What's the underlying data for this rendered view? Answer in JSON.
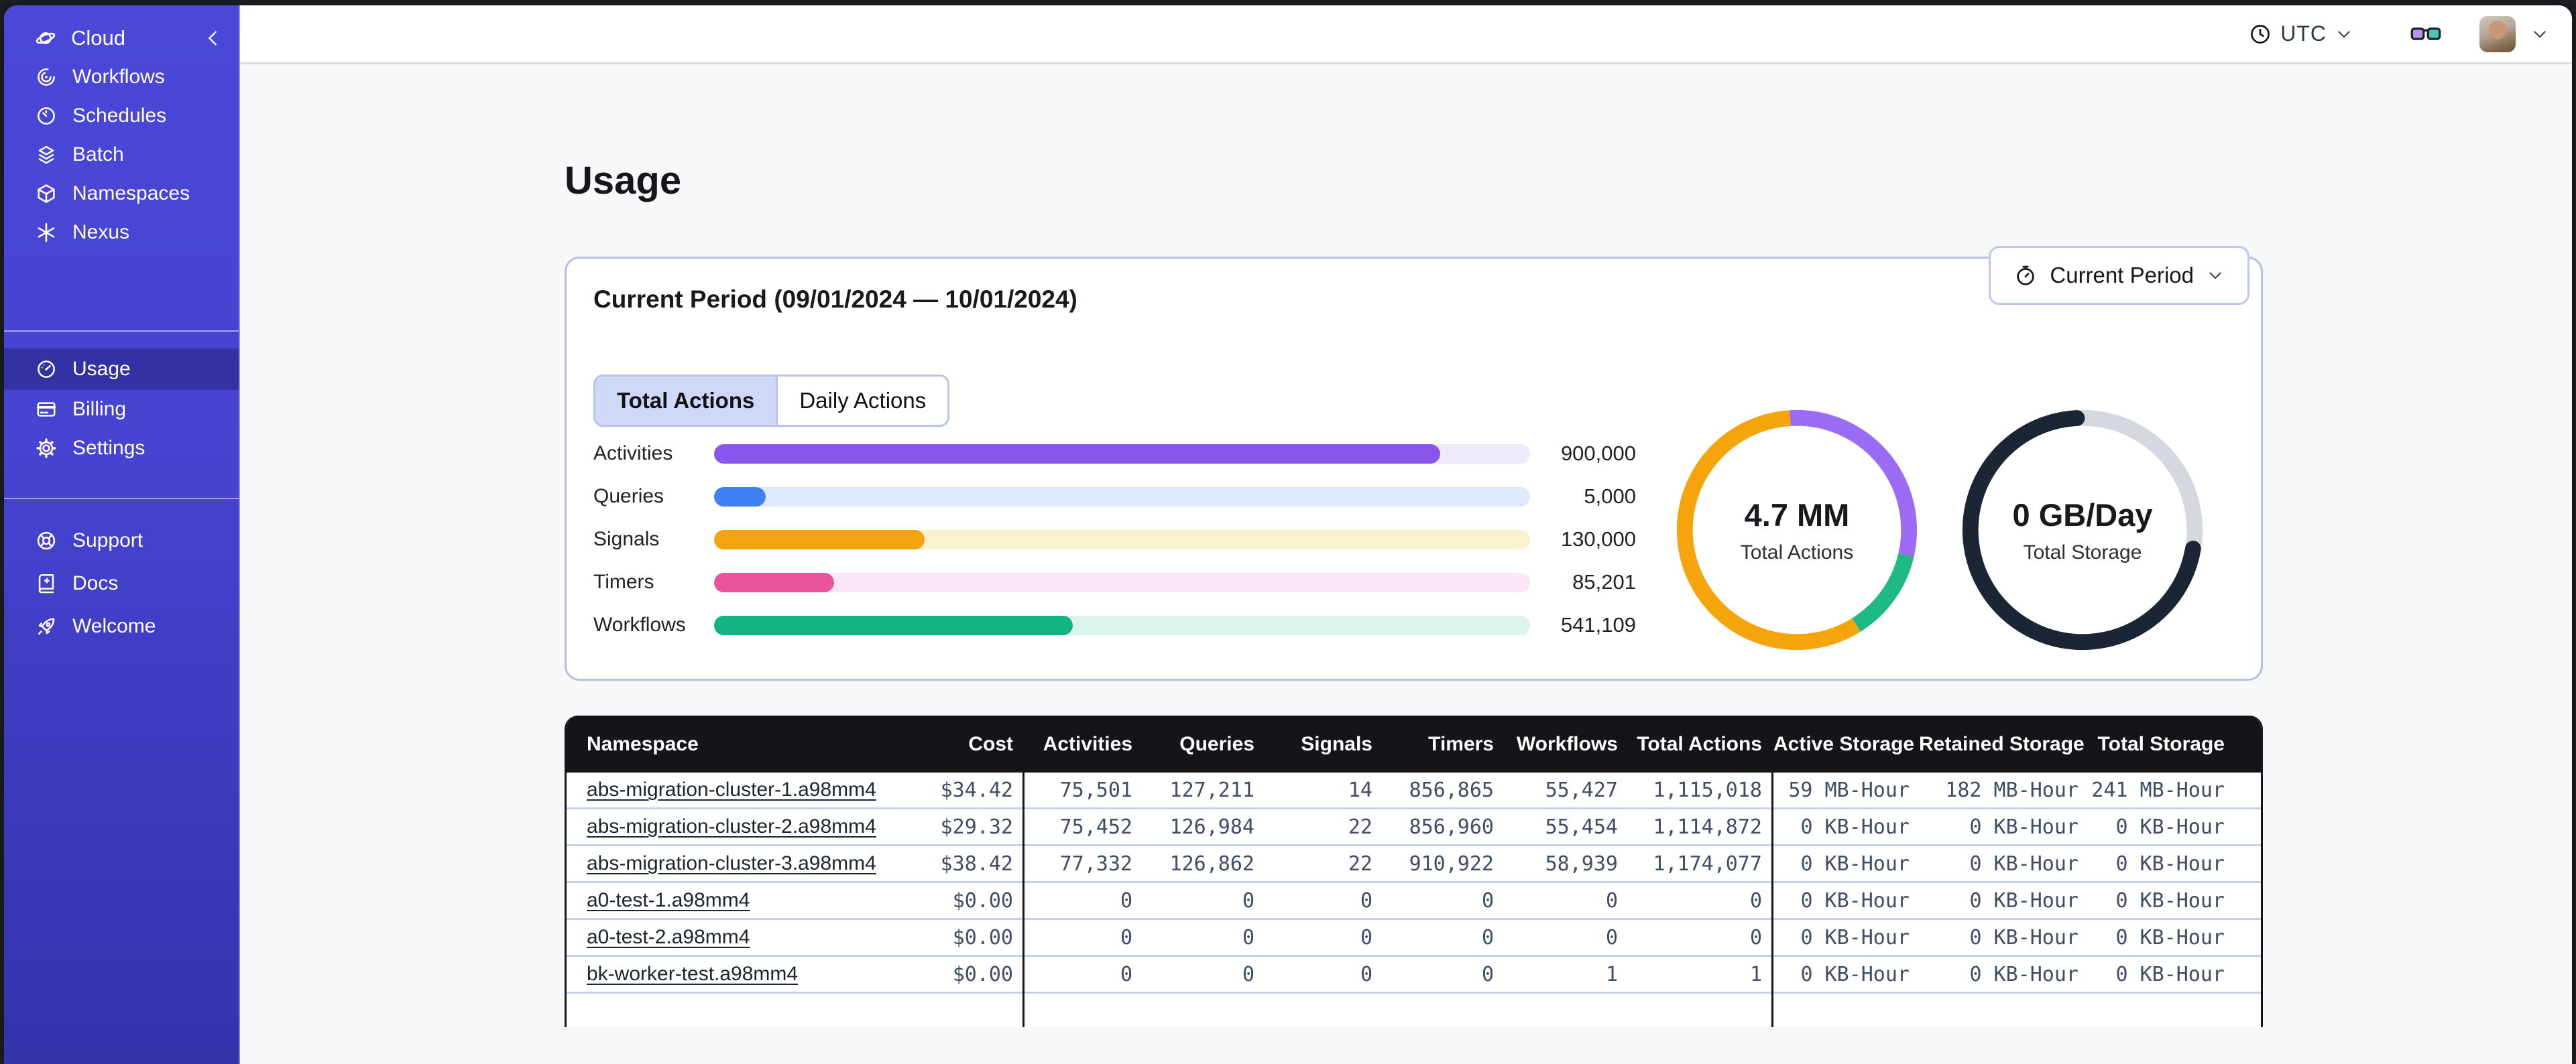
{
  "topbar": {
    "timezone_label": "UTC",
    "icons": [
      "clock-icon",
      "goggles-icon",
      "avatar",
      "chevron-down-icon"
    ]
  },
  "sidebar": {
    "brand": {
      "label": "Cloud",
      "collapse_icon": "chevron-left-icon"
    },
    "groups": [
      {
        "items": [
          {
            "icon": "workflows",
            "label": "Workflows"
          },
          {
            "icon": "schedules",
            "label": "Schedules"
          },
          {
            "icon": "batch",
            "label": "Batch"
          },
          {
            "icon": "namespaces",
            "label": "Namespaces"
          },
          {
            "icon": "nexus",
            "label": "Nexus"
          }
        ]
      },
      {
        "items": [
          {
            "icon": "usage",
            "label": "Usage",
            "active": true
          },
          {
            "icon": "billing",
            "label": "Billing"
          },
          {
            "icon": "settings",
            "label": "Settings"
          }
        ]
      },
      {
        "items": [
          {
            "icon": "support",
            "label": "Support"
          },
          {
            "icon": "docs",
            "label": "Docs"
          },
          {
            "icon": "welcome",
            "label": "Welcome"
          }
        ]
      }
    ]
  },
  "page": {
    "title": "Usage",
    "period_button_label": "Current Period",
    "card_title": "Current Period (09/01/2024 — 10/01/2024)",
    "tabs": [
      {
        "label": "Total Actions",
        "active": true
      },
      {
        "label": "Daily Actions",
        "active": false
      }
    ]
  },
  "chart_data": [
    {
      "type": "bar",
      "orientation": "horizontal",
      "categories": [
        "Activities",
        "Queries",
        "Signals",
        "Timers",
        "Workflows"
      ],
      "values": [
        900000,
        5000,
        130000,
        85201,
        541109
      ],
      "value_labels": [
        "900,000",
        "5,000",
        "130,000",
        "85,201",
        "541,109"
      ],
      "fill_fractions": [
        0.89,
        0.063,
        0.258,
        0.147,
        0.44
      ],
      "colors": [
        "#8A55EC",
        "#3F80F3",
        "#F3A30D",
        "#E9549D",
        "#12B483"
      ],
      "track_colors": [
        "#EFE9FC",
        "#DEE9FC",
        "#FCF1CF",
        "#FBE7F5",
        "#DBF4E9"
      ]
    },
    {
      "type": "donut",
      "label": "4.7 MM",
      "sublabel": "Total Actions",
      "start_angle_deg": -3,
      "linecap": "butt",
      "segments": [
        {
          "name": "activities",
          "color": "#9B6BF3",
          "fraction": 0.295
        },
        {
          "name": "workflows",
          "color": "#1FB985",
          "fraction": 0.125
        },
        {
          "name": "signals",
          "color": "#F5A40B",
          "fraction": 0.58
        }
      ]
    },
    {
      "type": "donut",
      "label": "0 GB/Day",
      "sublabel": "Total Storage",
      "start_angle_deg": 100,
      "linecap": "round",
      "track_color": "#D5D8DE",
      "segments": [
        {
          "name": "storage-used",
          "color": "#1C2534",
          "fraction": 0.715
        }
      ]
    }
  ],
  "table": {
    "columns": [
      {
        "label": "Namespace",
        "align": "left"
      },
      {
        "label": "Cost",
        "align": "right"
      },
      {
        "label": "Activities",
        "align": "right"
      },
      {
        "label": "Queries",
        "align": "right"
      },
      {
        "label": "Signals",
        "align": "right"
      },
      {
        "label": "Timers",
        "align": "right"
      },
      {
        "label": "Workflows",
        "align": "right"
      },
      {
        "label": "Total Actions",
        "align": "right"
      },
      {
        "label": "Active Storage",
        "align": "right"
      },
      {
        "label": "Retained Storage",
        "align": "right"
      },
      {
        "label": "Total Storage",
        "align": "right"
      }
    ],
    "divider_after_indices": [
      1,
      7
    ],
    "rows": [
      [
        "abs-migration-cluster-1.a98mm4",
        "$34.42",
        "75,501",
        "127,211",
        "14",
        "856,865",
        "55,427",
        "1,115,018",
        "59 MB-Hour",
        "182 MB-Hour",
        "241 MB-Hour"
      ],
      [
        "abs-migration-cluster-2.a98mm4",
        "$29.32",
        "75,452",
        "126,984",
        "22",
        "856,960",
        "55,454",
        "1,114,872",
        "0 KB-Hour",
        "0 KB-Hour",
        "0 KB-Hour"
      ],
      [
        "abs-migration-cluster-3.a98mm4",
        "$38.42",
        "77,332",
        "126,862",
        "22",
        "910,922",
        "58,939",
        "1,174,077",
        "0 KB-Hour",
        "0 KB-Hour",
        "0 KB-Hour"
      ],
      [
        "a0-test-1.a98mm4",
        "$0.00",
        "0",
        "0",
        "0",
        "0",
        "0",
        "0",
        "0 KB-Hour",
        "0 KB-Hour",
        "0 KB-Hour"
      ],
      [
        "a0-test-2.a98mm4",
        "$0.00",
        "0",
        "0",
        "0",
        "0",
        "0",
        "0",
        "0 KB-Hour",
        "0 KB-Hour",
        "0 KB-Hour"
      ],
      [
        "bk-worker-test.a98mm4",
        "$0.00",
        "0",
        "0",
        "0",
        "0",
        "1",
        "1",
        "0 KB-Hour",
        "0 KB-Hour",
        "0 KB-Hour"
      ]
    ]
  }
}
